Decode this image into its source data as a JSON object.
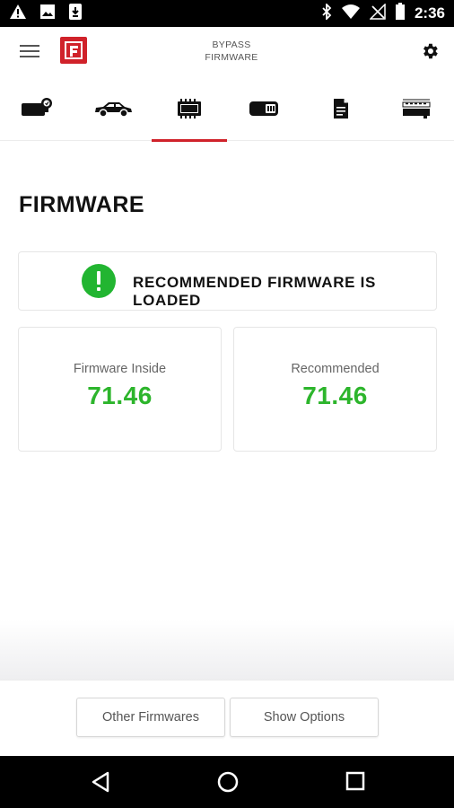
{
  "status_bar": {
    "time": "2:36",
    "icons": [
      "warning-icon",
      "image-icon",
      "download-icon",
      "bluetooth-icon",
      "wifi-icon",
      "no-signal-icon",
      "battery-icon"
    ]
  },
  "app_bar": {
    "title_line1": "BYPASS",
    "title_line2": "FIRMWARE",
    "icons": [
      "menu-icon",
      "app-logo",
      "settings-icon"
    ]
  },
  "tabs": [
    {
      "name": "module",
      "icon": "module-icon",
      "active": false
    },
    {
      "name": "vehicle",
      "icon": "car-icon",
      "active": false
    },
    {
      "name": "firmware",
      "icon": "chip-icon",
      "active": true
    },
    {
      "name": "battery",
      "icon": "battery-module-icon",
      "active": false
    },
    {
      "name": "document",
      "icon": "document-icon",
      "active": false
    },
    {
      "name": "device",
      "icon": "device-icon",
      "active": false
    }
  ],
  "main": {
    "title": "FIRMWARE",
    "status_message": "RECOMMENDED FIRMWARE IS LOADED",
    "firmware_inside_label": "Firmware Inside",
    "firmware_inside_value": "71.46",
    "recommended_label": "Recommended",
    "recommended_value": "71.46"
  },
  "actions": {
    "other_firmwares": "Other Firmwares",
    "show_options": "Show Options"
  },
  "colors": {
    "accent": "#d0222a",
    "success": "#2db52c",
    "text_dark": "#111111",
    "text_muted": "#666666"
  }
}
